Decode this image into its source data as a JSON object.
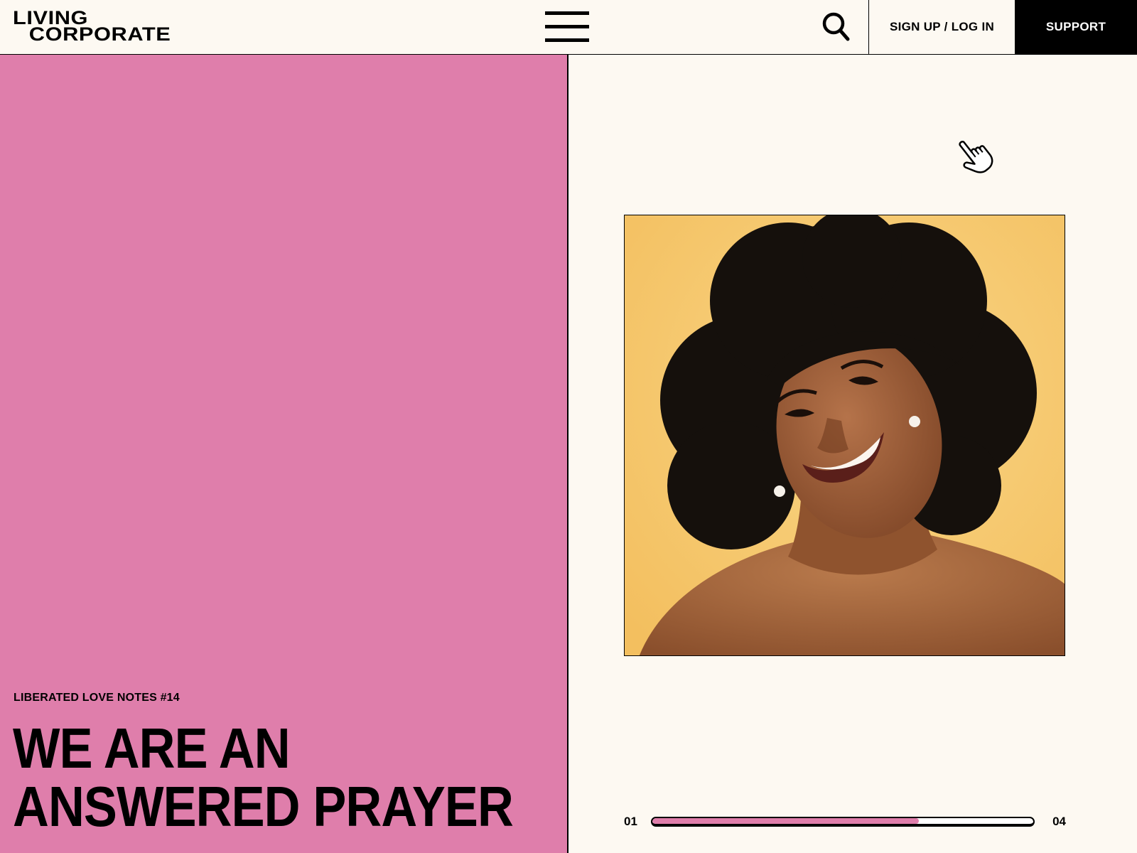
{
  "header": {
    "logo_line1": "LIVING",
    "logo_line2": "CORPORATE",
    "menu_icon": "hamburger-menu-icon",
    "search_icon": "search-icon",
    "signup_label": "SIGN UP / LOG IN",
    "support_label": "SUPPORT"
  },
  "feature": {
    "kicker": "LIBERATED LOVE NOTES #14",
    "headline_line1": "WE ARE AN",
    "headline_line2": "ANSWERED PRAYER",
    "image_icon": "portrait-photo",
    "image_alt": ""
  },
  "slider": {
    "current_label": "01",
    "total_label": "04",
    "progress_fraction": 0.7
  },
  "colors": {
    "accent_pink": "#df7eab",
    "page_background": "#fdf9f2",
    "photo_background": "#f6c66c",
    "black": "#000000"
  }
}
